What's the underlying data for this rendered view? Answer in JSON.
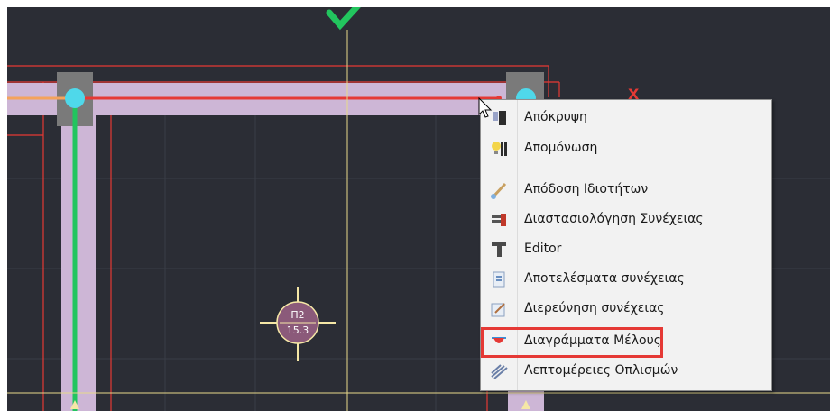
{
  "canvas": {
    "background": "#2b2d35",
    "axis_marker_y_color": "#22c55e",
    "axis_marker_x_label": "X",
    "axis_marker_x_color": "#e53935"
  },
  "pillar": {
    "name": "Π2",
    "value": "15.3"
  },
  "context_menu": {
    "items": [
      {
        "label": "Απόκρυψη",
        "icon": "hide-icon"
      },
      {
        "label": "Απομόνωση",
        "icon": "isolate-lightbulb-icon"
      },
      {
        "label": "Απόδοση Ιδιοτήτων",
        "icon": "brush-icon"
      },
      {
        "label": "Διαστασιολόγηση Συνέχειας",
        "icon": "dimensioning-icon"
      },
      {
        "label": "Editor",
        "icon": "editor-t-icon"
      },
      {
        "label": "Αποτελέσματα συνέχειας",
        "icon": "results-document-icon"
      },
      {
        "label": "Διερεύνηση συνέχειας",
        "icon": "investigation-icon"
      },
      {
        "label": "Διαγράμματα Μέλους",
        "icon": "member-diagrams-icon",
        "highlighted": true
      },
      {
        "label": "Λεπτομέρειες Οπλισμών",
        "icon": "reinforcement-details-icon"
      }
    ],
    "highlight_color": "#e53935"
  }
}
